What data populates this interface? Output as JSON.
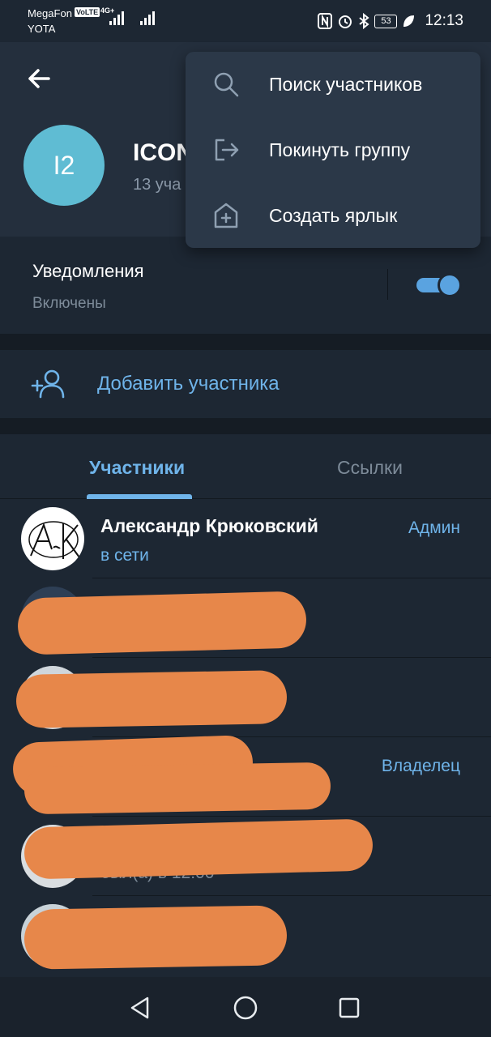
{
  "status_bar": {
    "carrier_primary": "MegaFon",
    "volte_badge": "VoLTE",
    "network": "4G+",
    "carrier_secondary": "YOTA",
    "battery": "53",
    "time": "12:13"
  },
  "header": {
    "avatar_initials": "I2",
    "title_visible": "ICON",
    "subtitle_visible": "13 уча"
  },
  "menu": {
    "items": [
      {
        "label": "Поиск участников",
        "icon": "search-icon"
      },
      {
        "label": "Покинуть группу",
        "icon": "leave-icon"
      },
      {
        "label": "Создать ярлык",
        "icon": "shortcut-icon"
      }
    ]
  },
  "notifications": {
    "title": "Уведомления",
    "status": "Включены",
    "enabled": true
  },
  "add_member": {
    "label": "Добавить участника"
  },
  "tabs": {
    "members": "Участники",
    "links": "Ссылки",
    "active": "members"
  },
  "members": [
    {
      "name": "Александр Крюковский",
      "status": "в сети",
      "role": "Админ"
    },
    {
      "name": "",
      "status": "",
      "role": ""
    },
    {
      "name": "",
      "status": "",
      "role": ""
    },
    {
      "name": "",
      "status": "",
      "role": "Владелец"
    },
    {
      "name": "",
      "status": "был(а) в 12:00",
      "role": ""
    },
    {
      "name": "",
      "status": "",
      "role": ""
    }
  ],
  "colors": {
    "background": "#1d2733",
    "header": "#242f3d",
    "accent": "#6fb4ea",
    "group_avatar": "#5fbcd3",
    "redaction": "#e7874a"
  }
}
